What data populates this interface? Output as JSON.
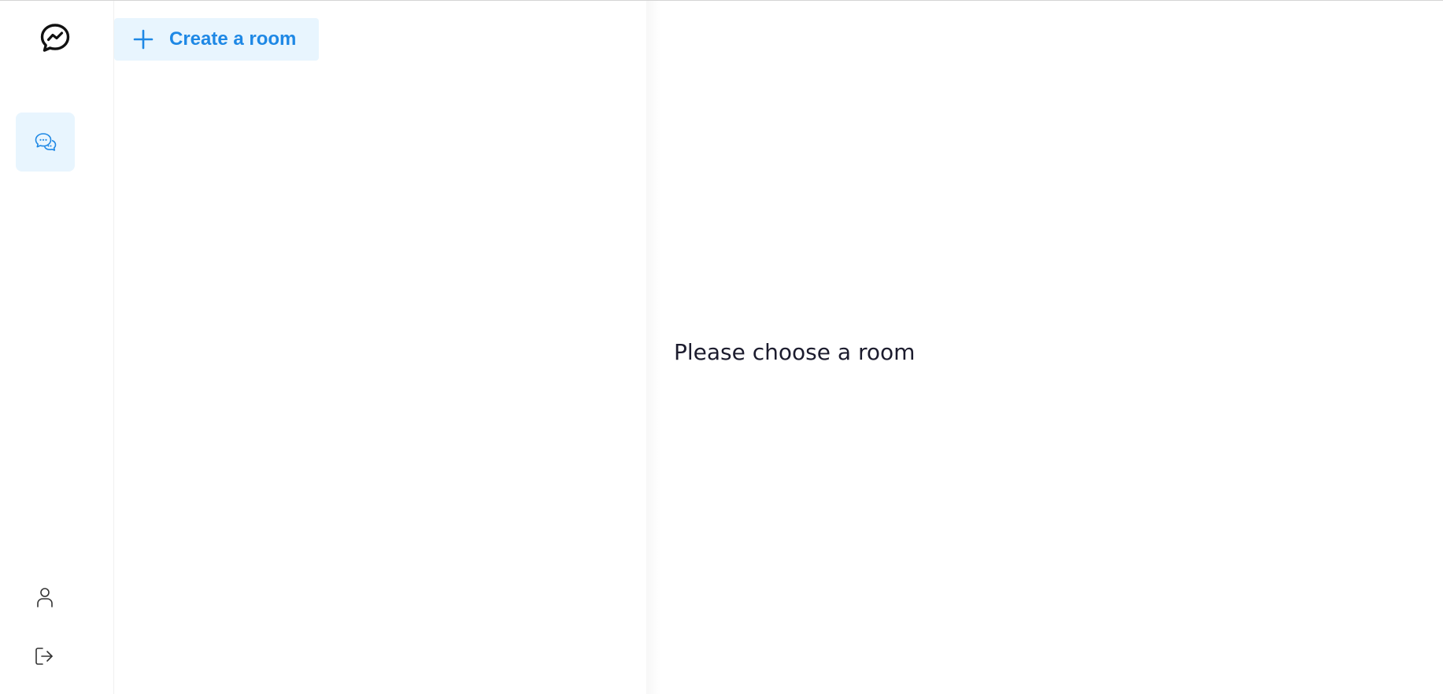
{
  "sidebar": {
    "logo_icon": "messenger-logo-icon",
    "items": [
      {
        "icon": "chat-bubbles-icon",
        "active": true
      },
      {
        "icon": "user-icon",
        "active": false
      },
      {
        "icon": "logout-icon",
        "active": false
      }
    ],
    "active_bg": "#e8f5fe",
    "accent": "#1e88e5"
  },
  "rooms": {
    "create_label": "Create a room",
    "create_icon": "plus-icon"
  },
  "main": {
    "empty_message": "Please choose a room"
  }
}
